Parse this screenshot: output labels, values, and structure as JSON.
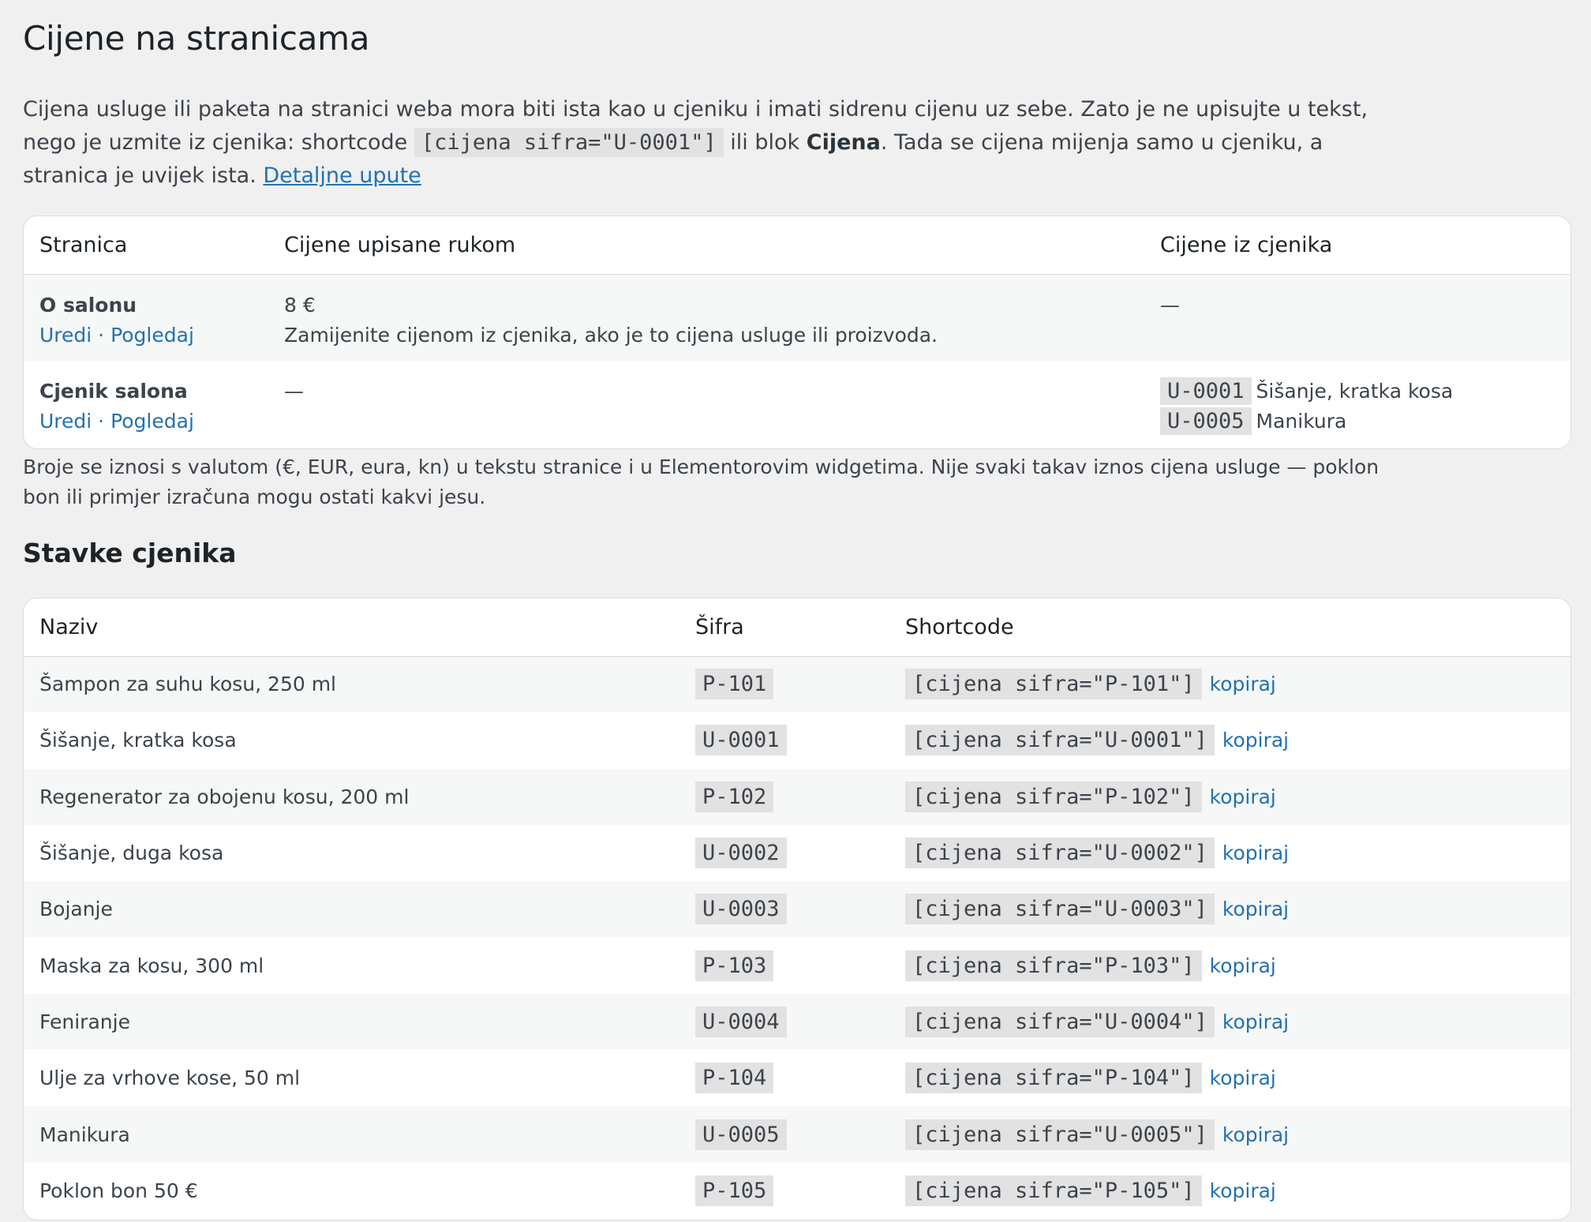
{
  "page_title": "Cijene na stranicama",
  "intro": {
    "line1": "Cijena usluge ili paketa na stranici weba mora biti ista kao u cjeniku i imati sidrenu cijenu uz sebe. Zato je ne upisujte u tekst,",
    "line2_before": "nego je uzmite iz cjenika: shortcode ",
    "shortcode_example": "[cijena sifra=\"U-0001\"]",
    "line2_middle": " ili blok ",
    "block_name": "Cijena",
    "line2_after": ". Tada se cijena mijenja samo u cjeniku, a",
    "line3": "stranica je uvijek ista. ",
    "details_link": "Detaljne upute"
  },
  "pages_table": {
    "headers": {
      "page": "Stranica",
      "manual_prices": "Cijene upisane rukom",
      "catalog_prices": "Cijene iz cjenika"
    },
    "edit_label": "Uredi",
    "separator": " · ",
    "view_label": "Pogledaj",
    "rows": [
      {
        "title": "O salonu",
        "manual_value": "8 €",
        "manual_hint": "Zamijenite cijenom iz cjenika, ako je to cijena usluge ili proizvoda.",
        "catalog_dash": "—"
      },
      {
        "title": "Cjenik salona",
        "manual_dash": "—",
        "catalog": [
          {
            "sku": "U-0001",
            "name": "Šišanje, kratka kosa"
          },
          {
            "sku": "U-0005",
            "name": "Manikura"
          }
        ]
      }
    ]
  },
  "note": {
    "line1": "Broje se iznosi s valutom (€, EUR, eura, kn) u tekstu stranice i u Elementorovim widgetima. Nije svaki takav iznos cijena usluge — poklon",
    "line2": "bon ili primjer izračuna mogu ostati kakvi jesu."
  },
  "items_heading": "Stavke cjenika",
  "items_table": {
    "headers": {
      "name": "Naziv",
      "sku": "Šifra",
      "shortcode": "Shortcode"
    },
    "copy_label": "kopiraj",
    "rows": [
      {
        "name": "Šampon za suhu kosu, 250 ml",
        "sku": "P-101",
        "shortcode": "[cijena sifra=\"P-101\"]"
      },
      {
        "name": "Šišanje, kratka kosa",
        "sku": "U-0001",
        "shortcode": "[cijena sifra=\"U-0001\"]"
      },
      {
        "name": "Regenerator za obojenu kosu, 200 ml",
        "sku": "P-102",
        "shortcode": "[cijena sifra=\"P-102\"]"
      },
      {
        "name": "Šišanje, duga kosa",
        "sku": "U-0002",
        "shortcode": "[cijena sifra=\"U-0002\"]"
      },
      {
        "name": "Bojanje",
        "sku": "U-0003",
        "shortcode": "[cijena sifra=\"U-0003\"]"
      },
      {
        "name": "Maska za kosu, 300 ml",
        "sku": "P-103",
        "shortcode": "[cijena sifra=\"P-103\"]"
      },
      {
        "name": "Feniranje",
        "sku": "U-0004",
        "shortcode": "[cijena sifra=\"U-0004\"]"
      },
      {
        "name": "Ulje za vrhove kose, 50 ml",
        "sku": "P-104",
        "shortcode": "[cijena sifra=\"P-104\"]"
      },
      {
        "name": "Manikura",
        "sku": "U-0005",
        "shortcode": "[cijena sifra=\"U-0005\"]"
      },
      {
        "name": "Poklon bon 50 €",
        "sku": "P-105",
        "shortcode": "[cijena sifra=\"P-105\"]"
      }
    ]
  },
  "colors": {
    "background": "#f0f0f1",
    "link": "#2271b1",
    "code_bg": "#e2e2e3",
    "row_alt": "#f6f7f7"
  }
}
